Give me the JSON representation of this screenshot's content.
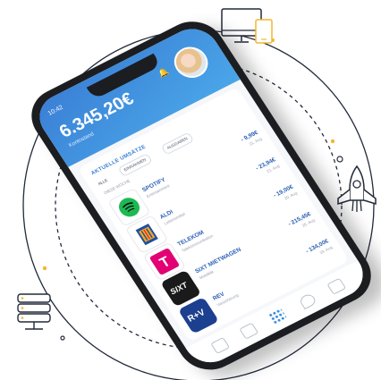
{
  "app": {
    "status_time": "10:42",
    "balance": "6.345,20€",
    "balance_caption": "Kontostand",
    "section_title": "AKTUELLE UMSÄTZE",
    "filters": [
      "ALLE",
      "EINNAHMEN",
      "AUSGABEN"
    ],
    "subheading": "DIESE WOCHE",
    "transactions": [
      {
        "merchant": "SPOTIFY",
        "subtitle": "Entertainment",
        "amount": "- 9,99€",
        "date": "21. Aug"
      },
      {
        "merchant": "ALDI",
        "subtitle": "Lebensmittel",
        "amount": "- 23,94€",
        "date": "21. Aug"
      },
      {
        "merchant": "TELEKOM",
        "subtitle": "Telekommunikation",
        "amount": "- 19,00€",
        "date": "20. Aug"
      },
      {
        "merchant": "SIXT MIETWAGEN",
        "subtitle": "Mobilität",
        "amount": "- 215,45€",
        "date": "20. Aug"
      },
      {
        "merchant": "REV",
        "subtitle": "Versicherung",
        "amount": "- 134,00€",
        "date": "19. Aug"
      }
    ],
    "logo_text": {
      "sixt": "SIXT",
      "rv": "R+V"
    }
  },
  "colors": {
    "brand_blue": "#3a7fd6",
    "orbit_dash": "#222a3a",
    "accent_dot": "#f2b632",
    "spotify": "#1db954",
    "telekom": "#e20074",
    "rv": "#1d3f8f"
  },
  "icons": [
    "monitor-icon",
    "tablet-icon",
    "rocket-icon",
    "server-icon",
    "bell-icon",
    "home-icon",
    "document-icon",
    "grid-icon",
    "location-icon",
    "chat-icon"
  ]
}
